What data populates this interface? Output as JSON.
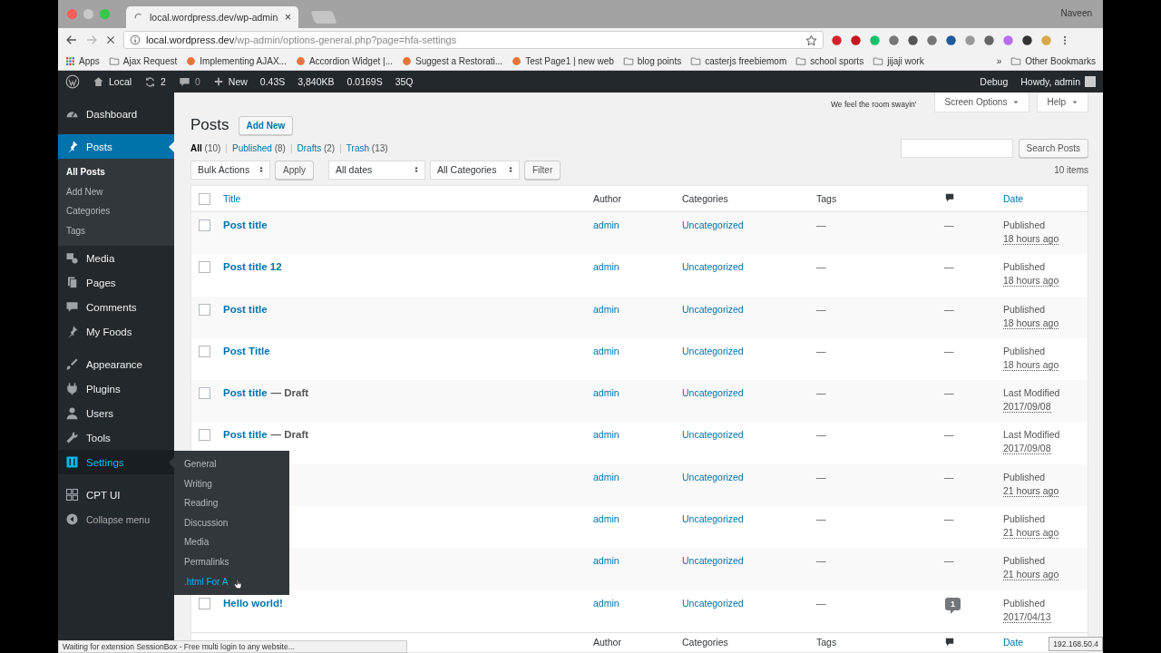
{
  "browser": {
    "tab": {
      "title": "local.wordpress.dev/wp-admin",
      "close": "×"
    },
    "profile": "Naveen",
    "address": {
      "host": "local.wordpress.dev",
      "path": "/wp-admin/options-general.php?page=hfa-settings"
    },
    "bookmarks": [
      {
        "label": "Apps",
        "kind": "apps"
      },
      {
        "label": "Ajax Request",
        "kind": "folder"
      },
      {
        "label": "Implementing AJAX...",
        "kind": "site"
      },
      {
        "label": "Accordion Widget |...",
        "kind": "site"
      },
      {
        "label": "Suggest a Restorati...",
        "kind": "site"
      },
      {
        "label": "Test Page1 | new web",
        "kind": "site"
      },
      {
        "label": "blog points",
        "kind": "folder"
      },
      {
        "label": "casterjs freebiemom",
        "kind": "folder"
      },
      {
        "label": "school sports",
        "kind": "folder"
      },
      {
        "label": "jijaji work",
        "kind": "folder"
      }
    ],
    "more_bookmarks": "»",
    "other_bookmarks": "Other Bookmarks"
  },
  "admin_bar": {
    "site": "Local",
    "updates": "2",
    "comments": "0",
    "new": "New",
    "stats": [
      "0.43S",
      "3,840KB",
      "0.0169S",
      "35Q"
    ],
    "debug": "Debug",
    "greeting": "Howdy, admin"
  },
  "sidebar": {
    "items": [
      {
        "kind": "item",
        "label": "Dashboard",
        "selected": false,
        "hover": false
      },
      {
        "kind": "separator"
      },
      {
        "kind": "item",
        "label": "Posts",
        "selected": true,
        "hover": false,
        "children": [
          {
            "label": "All Posts",
            "selected": true
          },
          {
            "label": "Add New",
            "selected": false
          },
          {
            "label": "Categories",
            "selected": false
          },
          {
            "label": "Tags",
            "selected": false
          }
        ]
      },
      {
        "kind": "item",
        "label": "Media",
        "selected": false,
        "hover": false
      },
      {
        "kind": "item",
        "label": "Pages",
        "selected": false,
        "hover": false
      },
      {
        "kind": "item",
        "label": "Comments",
        "selected": false,
        "hover": false
      },
      {
        "kind": "item",
        "label": "My Foods",
        "selected": false,
        "hover": false
      },
      {
        "kind": "separator"
      },
      {
        "kind": "item",
        "label": "Appearance",
        "selected": false,
        "hover": false
      },
      {
        "kind": "item",
        "label": "Plugins",
        "selected": false,
        "hover": false
      },
      {
        "kind": "item",
        "label": "Users",
        "selected": false,
        "hover": false
      },
      {
        "kind": "item",
        "label": "Tools",
        "selected": false,
        "hover": false
      },
      {
        "kind": "item",
        "label": "Settings",
        "selected": false,
        "hover": true
      },
      {
        "kind": "separator"
      },
      {
        "kind": "item",
        "label": "CPT UI",
        "selected": false,
        "hover": false
      },
      {
        "kind": "collapse",
        "label": "Collapse menu"
      }
    ],
    "flyout": [
      {
        "label": "General",
        "hover": false
      },
      {
        "label": "Writing",
        "hover": false
      },
      {
        "label": "Reading",
        "hover": false
      },
      {
        "label": "Discussion",
        "hover": false
      },
      {
        "label": "Media",
        "hover": false
      },
      {
        "label": "Permalinks",
        "hover": false
      },
      {
        "label": ".html For A",
        "hover": true
      }
    ]
  },
  "page": {
    "title": "Posts",
    "add_new": "Add New",
    "dolly": "We feel the room swayin'",
    "screen_options": "Screen Options",
    "help": "Help",
    "views": [
      {
        "label": "All",
        "count": "(10)",
        "selected": true
      },
      {
        "separator": "|",
        "label": "Published",
        "count": "(8)",
        "selected": false
      },
      {
        "separator": "|",
        "label": "Drafts",
        "count": "(2)",
        "selected": false
      },
      {
        "separator": "|",
        "label": "Trash",
        "count": "(13)",
        "selected": false
      }
    ],
    "search_button": "Search Posts",
    "bulk_actions": "Bulk Actions",
    "apply": "Apply",
    "dates": "All dates",
    "categories": "All Categories",
    "filter": "Filter",
    "items_count": "10 items"
  },
  "table": {
    "select_all_checked": false,
    "columns": [
      "Title",
      "Author",
      "Categories",
      "Tags",
      "Date"
    ],
    "rows": [
      {
        "title": "Post title",
        "checked": false,
        "author": "admin",
        "category": "Uncategorized",
        "tags": "—",
        "comments": "—",
        "status": "Published",
        "date": "18 hours ago"
      },
      {
        "title": "Post title 12",
        "checked": false,
        "author": "admin",
        "category": "Uncategorized",
        "tags": "—",
        "comments": "—",
        "status": "Published",
        "date": "18 hours ago"
      },
      {
        "title": "Post title",
        "checked": false,
        "author": "admin",
        "category": "Uncategorized",
        "tags": "—",
        "comments": "—",
        "status": "Published",
        "date": "18 hours ago"
      },
      {
        "title": "Post Title",
        "checked": false,
        "author": "admin",
        "category": "Uncategorized",
        "tags": "—",
        "comments": "—",
        "status": "Published",
        "date": "18 hours ago"
      },
      {
        "title": "Post title",
        "state": "— Draft",
        "checked": false,
        "author": "admin",
        "category": "Uncategorized",
        "tags": "—",
        "comments": "—",
        "status": "Last Modified",
        "date": "2017/09/08"
      },
      {
        "title": "Post title",
        "state": "— Draft",
        "checked": false,
        "author": "admin",
        "category": "Uncategorized",
        "tags": "—",
        "comments": "—",
        "status": "Last Modified",
        "date": "2017/09/08"
      },
      {
        "author": "admin",
        "category": "Uncategorized",
        "tags": "—",
        "comments": "—",
        "status": "Published",
        "date": "21 hours ago"
      },
      {
        "author": "admin",
        "category": "Uncategorized",
        "tags": "—",
        "comments": "—",
        "status": "Published",
        "date": "21 hours ago"
      },
      {
        "author": "admin",
        "category": "Uncategorized",
        "tags": "—",
        "comments": "—",
        "status": "Published",
        "date": "21 hours ago"
      },
      {
        "title": "Hello world!",
        "checked": false,
        "author": "admin",
        "category": "Uncategorized",
        "tags": "—",
        "comment_count": "1",
        "status": "Published",
        "date": "2017/04/13"
      }
    ],
    "footer_columns": [
      "Author",
      "Categories",
      "Tags",
      "Date"
    ]
  },
  "status_bar": "Waiting for extension SessionBox - Free multi login to any website...",
  "link_tooltip": "192.168.50.4"
}
